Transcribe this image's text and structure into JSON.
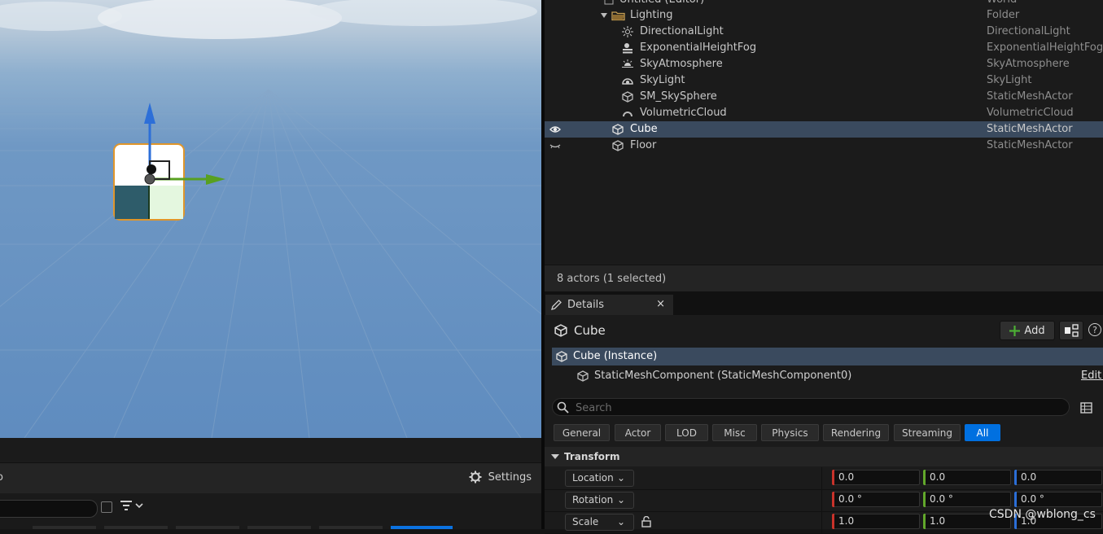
{
  "outliner": {
    "rows": [
      {
        "label": "Untitled (Editor)",
        "type": "World"
      },
      {
        "label": "Lighting",
        "type": "Folder"
      },
      {
        "label": "DirectionalLight",
        "type": "DirectionalLight"
      },
      {
        "label": "ExponentialHeightFog",
        "type": "ExponentialHeightFog"
      },
      {
        "label": "SkyAtmosphere",
        "type": "SkyAtmosphere"
      },
      {
        "label": "SkyLight",
        "type": "SkyLight"
      },
      {
        "label": "SM_SkySphere",
        "type": "StaticMeshActor"
      },
      {
        "label": "VolumetricCloud",
        "type": "VolumetricCloud"
      },
      {
        "label": "Cube",
        "type": "StaticMeshActor"
      },
      {
        "label": "Floor",
        "type": "StaticMeshActor"
      }
    ],
    "status": "8 actors (1 selected)"
  },
  "content_browser": {
    "settings_label": "Settings",
    "cut_label": "o"
  },
  "details": {
    "tab_label": "Details",
    "close_glyph": "×",
    "actor_name": "Cube",
    "add_label": "Add",
    "help_glyph": "?",
    "components": [
      {
        "label": "Cube (Instance)"
      },
      {
        "label": "StaticMeshComponent (StaticMeshComponent0)",
        "action": "Edit i"
      }
    ],
    "search_placeholder": "Search",
    "filter_tabs": [
      "General",
      "Actor",
      "LOD",
      "Misc",
      "Physics",
      "Rendering",
      "Streaming",
      "All"
    ],
    "active_tab": "All",
    "section_title": "Transform",
    "properties": [
      {
        "label": "Location",
        "x": "0.0",
        "y": "0.0",
        "z": "0.0"
      },
      {
        "label": "Rotation",
        "x": "0.0 °",
        "y": "0.0 °",
        "z": "0.0 °"
      },
      {
        "label": "Scale",
        "x": "1.0",
        "y": "1.0",
        "z": "1.0"
      }
    ]
  },
  "watermark": "CSDN @wblong_cs",
  "colors": {
    "accent": "#0070e0",
    "selection": "#3a4a5e",
    "x_axis": "#c8322a",
    "y_axis": "#62a82b",
    "z_axis": "#2b6ed6",
    "gizmo_x": "#58a020",
    "gizmo_z": "#2d6fd8"
  }
}
